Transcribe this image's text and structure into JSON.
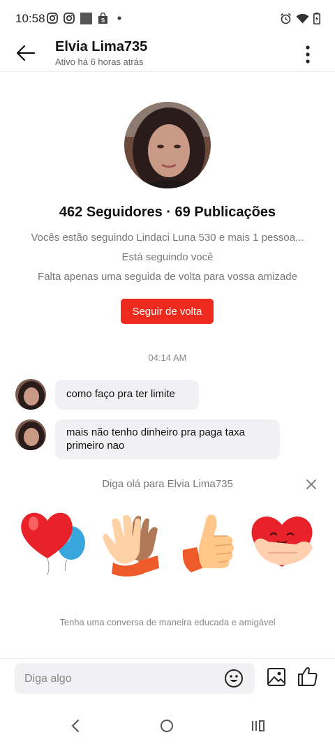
{
  "status_bar": {
    "time": "10:58",
    "icons": [
      "instagram-icon",
      "instagram-icon",
      "square-icon",
      "shopping-bag-icon",
      "dot-icon",
      "alarm-icon",
      "wifi-icon",
      "battery-icon"
    ]
  },
  "header": {
    "name": "Elvia Lima735",
    "subtitle": "Ativo há 6 horas atrás"
  },
  "profile": {
    "stats": "462 Seguidores · 69 Publicações",
    "mutual": "Vocês estão seguindo Lindaci Luna 530 e mais 1 pessoa...",
    "follows_you": "Está seguindo você",
    "hint": "Falta apenas uma seguida de volta para vossa amizade",
    "follow_back_label": "Seguir de volta"
  },
  "chat": {
    "timestamp": "04:14 AM",
    "messages": [
      {
        "line1": "como faço pra ter limite",
        "line2": ""
      },
      {
        "line1": "mais não tenho dinheiro pra paga taxa",
        "line2": "primeiro nao"
      }
    ]
  },
  "greeting": {
    "text": "Diga olá para Elvia Lima735",
    "stickers": [
      "heart-balloons-sticker",
      "waving-hands-sticker",
      "thumbs-up-sticker",
      "hugging-heart-sticker"
    ],
    "polite_note": "Tenha uma conversa de maneira educada e amigável"
  },
  "input": {
    "placeholder": "Diga algo"
  },
  "colors": {
    "accent": "#ee2a1f",
    "bubble": "#f1f1f3",
    "muted_text": "#777777"
  }
}
